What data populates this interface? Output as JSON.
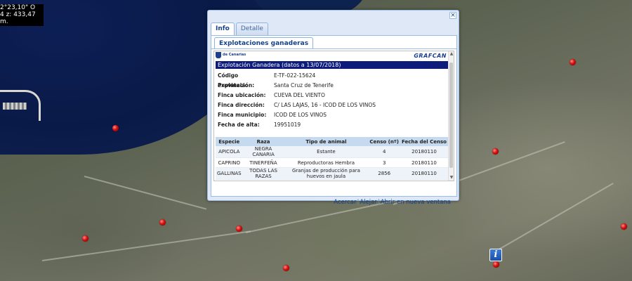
{
  "map": {
    "coordinates": {
      "line1": "2°23,10\" O",
      "line2": "4   z: 433,47 m."
    },
    "markers": [
      {
        "label": "livestock-farm"
      },
      {
        "label": "livestock-farm"
      },
      {
        "label": "livestock-farm"
      },
      {
        "label": "livestock-farm"
      },
      {
        "label": "livestock-farm"
      },
      {
        "label": "livestock-farm"
      },
      {
        "label": "livestock-farm"
      },
      {
        "label": "livestock-farm"
      },
      {
        "label": "livestock-farm"
      }
    ],
    "info_marker_glyph": "i",
    "colors": {
      "sea": "#0a1a48",
      "marker": "#d60d0d",
      "info_marker": "#1a4fa8"
    }
  },
  "popup": {
    "close_glyph": "×",
    "tabs": [
      {
        "label": "Info",
        "active": true
      },
      {
        "label": "Detalle",
        "active": false
      }
    ],
    "subtab": "Explotaciones ganaderas",
    "report": {
      "logo_left": "de Canarias",
      "logo_right": "GRAFCAN",
      "title": "Explotación Ganadera (datos a 13/07/2018)",
      "fields": [
        {
          "key": "Código explotación:",
          "value": "E-TF-022-15624"
        },
        {
          "key": "Provincia:",
          "value": "Santa Cruz de Tenerife"
        },
        {
          "key": "Finca ubicación:",
          "value": "CUEVA DEL VIENTO"
        },
        {
          "key": "Finca dirección:",
          "value": "C/ LAS LAJAS, 16 - ICOD DE LOS VINOS"
        },
        {
          "key": "Finca municipio:",
          "value": "ICOD DE LOS VINOS"
        },
        {
          "key": "Fecha de alta:",
          "value": "19951019"
        }
      ],
      "table": {
        "headers": [
          "Especie",
          "Raza",
          "Tipo de animal",
          "Censo (nº)",
          "Fecha del Censo"
        ],
        "rows": [
          [
            "APICOLA",
            "NEGRA CANARIA",
            "Estante",
            "4",
            "20180110"
          ],
          [
            "CAPRINO",
            "TINERFEÑA",
            "Reproductoras Hembra",
            "3",
            "20180110"
          ],
          [
            "GALLINAS",
            "TODAS LAS RAZAS",
            "Granjas de producción para huevos en jaula",
            "2856",
            "20180110"
          ]
        ]
      }
    },
    "actions": {
      "zoom_in": "Acercar",
      "separator": "|",
      "zoom_out": "Alejar",
      "open_new_window": "Abrir en nueva ventana"
    }
  }
}
